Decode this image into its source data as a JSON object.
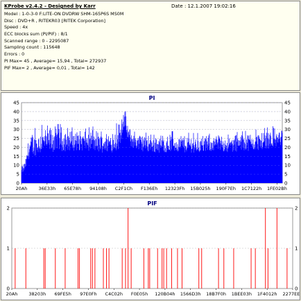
{
  "info": {
    "title": "KProbe v2.4.2 - Designed by Karr",
    "date": "Date : 12.1.2007 19:02:16",
    "lines": [
      "Model : 1-0-3-0 F:LITE-ON DVDRW SHM-165P6S MS0M",
      "Disc : DVD+R , RITEKR03 [RITEK Corporation]",
      "Speed : 4x",
      "ECC blocks sum (PI/PIF) : 8/1",
      "Scanned range : 0 - 2295087",
      "Sampling count : 115648",
      "Errors : 0",
      "PI Max= 45 , Average= 15,94 , Total= 272937",
      "PIF Max= 2 , Average= 0,01 , Total= 142"
    ]
  },
  "chart_data": [
    {
      "type": "area",
      "title": "PI",
      "x_tick_labels": [
        "20Ah",
        "36E33h",
        "65E78h",
        "94108h",
        "C2F1Ch",
        "F136Eh",
        "12323Fh",
        "15B025h",
        "190F7Eh",
        "1C7122h",
        "1FE02Bh"
      ],
      "y_ticks": [
        0,
        5,
        10,
        15,
        20,
        25,
        30,
        35,
        40,
        45
      ],
      "ylim": [
        0,
        45
      ],
      "grid": true,
      "series": [
        {
          "color": "#0000ff",
          "segments": [
            {
              "x": [
                0.0,
                0.01,
                0.02,
                0.025,
                0.04,
                0.07,
                0.1,
                0.14,
                0.18,
                0.22,
                0.26,
                0.3,
                0.34,
                0.37,
                0.385,
                0.39,
                0.395,
                0.4,
                0.41,
                0.42,
                0.45,
                0.5,
                0.55,
                0.6,
                0.65,
                0.7,
                0.75,
                0.8,
                0.85,
                0.9,
                0.94,
                0.97,
                1.0
              ],
              "base": [
                5,
                6,
                9,
                13,
                15,
                16,
                17,
                17,
                18,
                18,
                18,
                17,
                17,
                18,
                25,
                30,
                31,
                27,
                22,
                20,
                18,
                17,
                17,
                17,
                17,
                17,
                18,
                17,
                18,
                18,
                19,
                20,
                21
              ],
              "peak": [
                10,
                12,
                18,
                26,
                30,
                32,
                34,
                33,
                33,
                32,
                32,
                31,
                31,
                34,
                42,
                45,
                44,
                40,
                34,
                31,
                30,
                29,
                29,
                29,
                28,
                28,
                29,
                28,
                29,
                30,
                31,
                32,
                33
              ]
            }
          ]
        }
      ]
    },
    {
      "type": "bar",
      "title": "PIF",
      "x_tick_labels": [
        "20Ah",
        "38203h",
        "69FE5h",
        "97E0Fh",
        "C4C02h",
        "F0E05h",
        "120B04h",
        "1566D3h",
        "18B7F0h",
        "1BEE03h",
        "1F4012h",
        "2277EEh"
      ],
      "y_ticks": [
        0,
        1,
        2
      ],
      "ylim": [
        0,
        2
      ],
      "grid": true,
      "series": [
        {
          "color": "#ff0000",
          "positions": [
            0.012,
            0.05,
            0.114,
            0.119,
            0.155,
            0.19,
            0.236,
            0.241,
            0.281,
            0.287,
            0.296,
            0.326,
            0.337,
            0.346,
            0.393,
            0.405,
            0.414,
            0.425,
            0.47,
            0.486,
            0.491,
            0.519,
            0.535,
            0.541,
            0.551,
            0.569,
            0.59,
            0.606,
            0.666,
            0.676,
            0.736,
            0.755,
            0.79,
            0.852,
            0.867,
            0.903,
            0.912,
            0.944,
            0.98
          ],
          "values": [
            1,
            1,
            1,
            1,
            1,
            1,
            1,
            1,
            1,
            1,
            1,
            1,
            1,
            1,
            1,
            1,
            2,
            1,
            1,
            1,
            1,
            1,
            1,
            1,
            1,
            1,
            1,
            1,
            1,
            1,
            1,
            1,
            1,
            1,
            1,
            2,
            1,
            2,
            1
          ]
        }
      ]
    }
  ],
  "colors": {
    "panel_bg": "#ece9d8",
    "info_bg": "#fffff0",
    "pi_fill": "#0000ff",
    "pif_bar": "#ff0000",
    "title_color": "#000080",
    "grid": "#c0c0c0"
  }
}
